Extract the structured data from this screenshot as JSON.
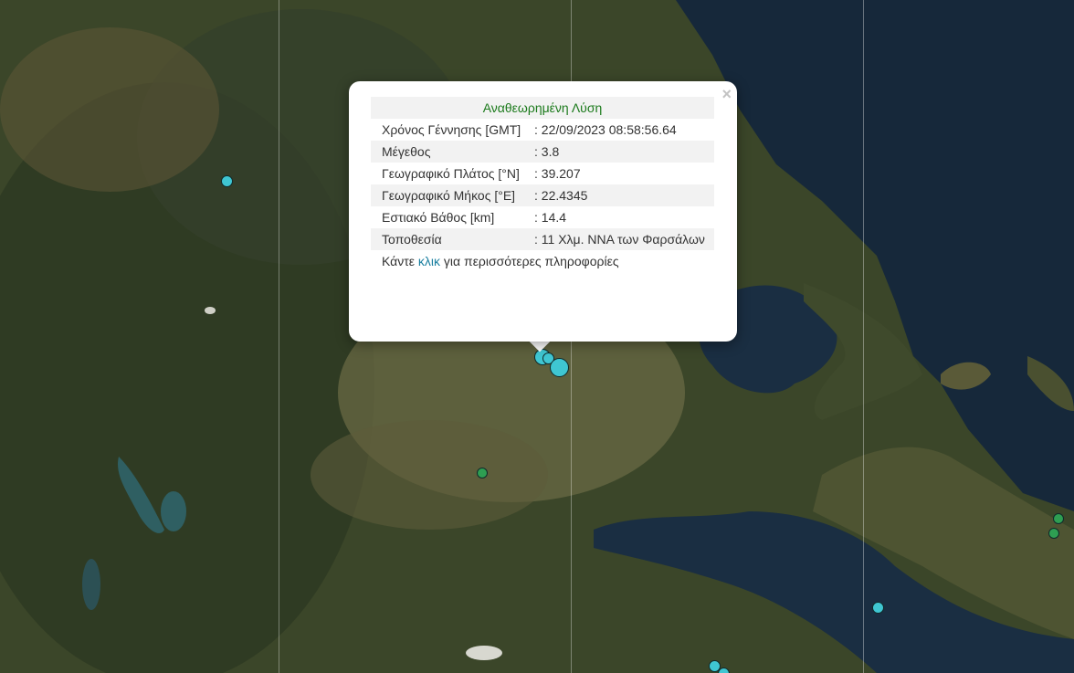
{
  "popup": {
    "title": "Αναθεωρημένη Λύση",
    "rows": [
      {
        "label": "Χρόνος Γέννησης [GMT]",
        "value": ": 22/09/2023 08:58:56.64"
      },
      {
        "label": "Μέγεθος",
        "value": ": 3.8"
      },
      {
        "label": "Γεωγραφικό Πλάτος [°N]",
        "value": ": 39.207"
      },
      {
        "label": "Γεωγραφικό Μήκος [°E]",
        "value": ": 22.4345"
      },
      {
        "label": "Εστιακό Βάθος [km]",
        "value": ": 14.4"
      },
      {
        "label": "Τοποθεσία",
        "value": ": 11 Χλμ. ΝΝΑ των Φαρσάλων"
      }
    ],
    "footer_before": "Κάντε ",
    "footer_link": "κλικ",
    "footer_after": " για περισσότερες πληροφορίες",
    "close": "×"
  },
  "colors": {
    "marker_cyan": "#3fc6d2",
    "marker_green": "#2e9e52",
    "popup_title": "#1b7a1b",
    "link": "#1a7fa0"
  },
  "icons": {
    "close": "close-icon",
    "marker": "earthquake-marker-icon"
  }
}
